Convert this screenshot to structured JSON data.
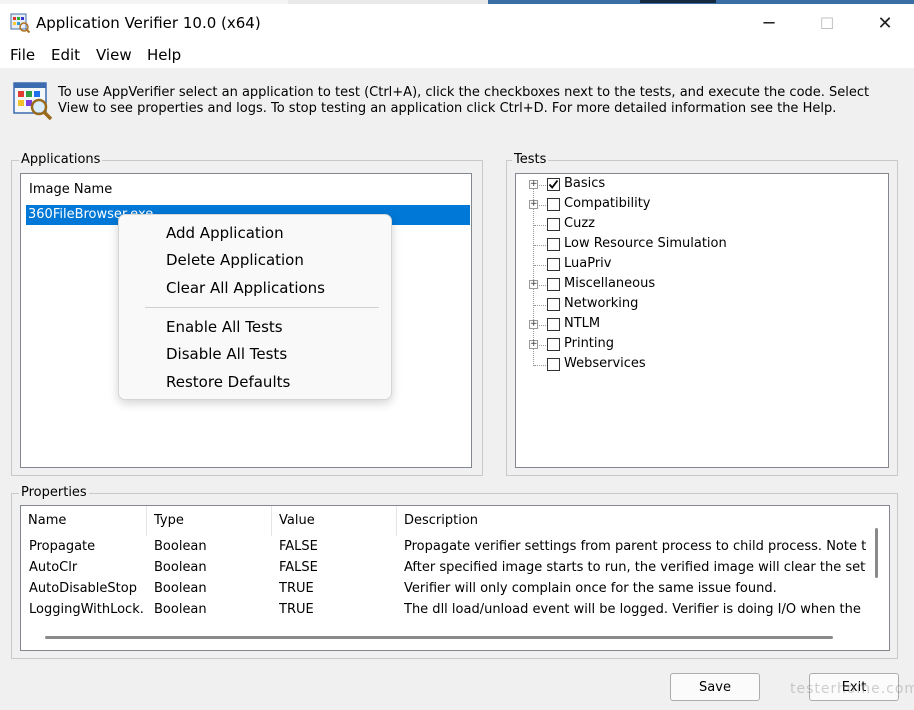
{
  "window": {
    "title": "Application Verifier 10.0 (x64)",
    "minimize_glyph": "─",
    "maximize_glyph": "☐",
    "close_glyph": "✕"
  },
  "menu": [
    "File",
    "Edit",
    "View",
    "Help"
  ],
  "intro": "To use AppVerifier select an application to test (Ctrl+A), click the checkboxes next to the tests, and execute the code. Select View to see properties and logs. To stop testing an application click Ctrl+D. For more detailed information see the Help.",
  "applications": {
    "label": "Applications",
    "column_header": "Image Name",
    "items": [
      "360FileBrowser.exe"
    ]
  },
  "context_menu": {
    "items": [
      "Add Application",
      "Delete Application",
      "Clear All Applications",
      "Enable All Tests",
      "Disable All Tests",
      "Restore Defaults"
    ]
  },
  "tests": {
    "label": "Tests",
    "items": [
      {
        "label": "Basics",
        "checked": true,
        "expandable": true
      },
      {
        "label": "Compatibility",
        "checked": false,
        "expandable": true
      },
      {
        "label": "Cuzz",
        "checked": false,
        "expandable": false
      },
      {
        "label": "Low Resource Simulation",
        "checked": false,
        "expandable": false
      },
      {
        "label": "LuaPriv",
        "checked": false,
        "expandable": false
      },
      {
        "label": "Miscellaneous",
        "checked": false,
        "expandable": true
      },
      {
        "label": "Networking",
        "checked": false,
        "expandable": false
      },
      {
        "label": "NTLM",
        "checked": false,
        "expandable": true
      },
      {
        "label": "Printing",
        "checked": false,
        "expandable": true
      },
      {
        "label": "Webservices",
        "checked": false,
        "expandable": false
      }
    ]
  },
  "properties": {
    "label": "Properties",
    "columns": [
      "Name",
      "Type",
      "Value",
      "Description"
    ],
    "rows": [
      [
        "Propagate",
        "Boolean",
        "FALSE",
        "Propagate verifier settings from parent process to child process. Note that ..."
      ],
      [
        "AutoClr",
        "Boolean",
        "FALSE",
        "After specified image starts to run, the verified image will clear the settings..."
      ],
      [
        "AutoDisableStop",
        "Boolean",
        "TRUE",
        "Verifier will only complain once for the same issue found."
      ],
      [
        "LoggingWithLock...",
        "Boolean",
        "TRUE",
        "The dll load/unload event will be logged. Verifier is doing I/O when the load..."
      ]
    ]
  },
  "buttons": {
    "save": "Save",
    "exit": "Exit"
  },
  "watermark": "testerhome.com",
  "colors": {
    "selection": "#0078d7",
    "topstrip": "#3a6ea5"
  }
}
